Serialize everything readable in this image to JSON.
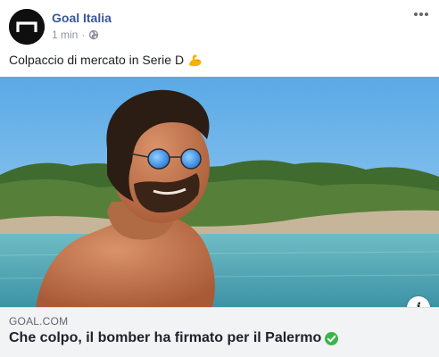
{
  "post": {
    "page_name": "Goal Italia",
    "timestamp": "1 min",
    "separator": "·",
    "privacy_icon": "globe-icon",
    "menu_icon": "more-options-icon",
    "text": "Colpaccio di mercato in Serie D",
    "text_emoji": "flexed-biceps-icon"
  },
  "link_card": {
    "domain": "GOAL.COM",
    "headline": "Che colpo, il bomber ha firmato per il Palermo",
    "headline_emoji": "check-mark-button-icon",
    "info_label": "i"
  },
  "colors": {
    "page_name": "#385898",
    "meta_text": "#90949c",
    "caption_bg": "#f2f3f5",
    "check_green": "#3ab54a",
    "avatar_bg": "#0f0f10"
  }
}
